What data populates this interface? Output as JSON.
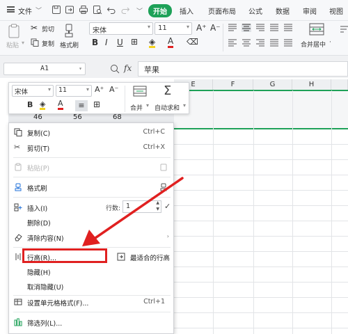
{
  "menubar": {
    "file_label": "文件",
    "tabs": [
      {
        "label": "开始",
        "active": true
      },
      {
        "label": "插入",
        "active": false
      },
      {
        "label": "页面布局",
        "active": false
      },
      {
        "label": "公式",
        "active": false
      },
      {
        "label": "数据",
        "active": false
      },
      {
        "label": "审阅",
        "active": false
      },
      {
        "label": "视图",
        "active": false
      }
    ],
    "active_color": "#1ea158"
  },
  "ribbon": {
    "paste": "粘贴",
    "cut": "剪切",
    "copy": "复制",
    "format_painter": "格式刷",
    "font_name": "宋体",
    "font_size": "11",
    "grow": "A⁺",
    "shrink": "A⁻",
    "merge_center": "合并居中",
    "merge_caret": "·"
  },
  "formula": {
    "cell_ref": "A1",
    "fx_label": "fx",
    "value": "苹果"
  },
  "grid": {
    "columns": [
      "E",
      "F",
      "G",
      "H"
    ],
    "row_visible_values": [
      "46",
      "56",
      "68"
    ],
    "accent": "#1ea158"
  },
  "minitoolbar": {
    "font_name": "宋体",
    "font_size": "11",
    "merge": "合并",
    "autosum": "自动求和"
  },
  "context_menu": {
    "items": {
      "copy": {
        "label": "复制(C)",
        "shortcut": "Ctrl+C"
      },
      "cut": {
        "label": "剪切(T)",
        "shortcut": "Ctrl+X"
      },
      "paste": {
        "label": "粘贴(P)"
      },
      "format_painter": {
        "label": "格式刷"
      },
      "insert": {
        "label": "插入(I)",
        "rows_label": "行数:",
        "rows_value": "1"
      },
      "delete": {
        "label": "删除(D)"
      },
      "clear": {
        "label": "清除内容(N)"
      },
      "row_height": {
        "label": "行高(R)..."
      },
      "best_fit": {
        "label": "最适合的行高"
      },
      "hide": {
        "label": "隐藏(H)"
      },
      "unhide": {
        "label": "取消隐藏(U)"
      },
      "format_cells": {
        "label": "设置单元格格式(F)...",
        "shortcut": "Ctrl+1"
      },
      "filter_columns": {
        "label": "筛选列(L)..."
      }
    }
  },
  "annotation": {
    "highlight_color": "#e02020"
  }
}
